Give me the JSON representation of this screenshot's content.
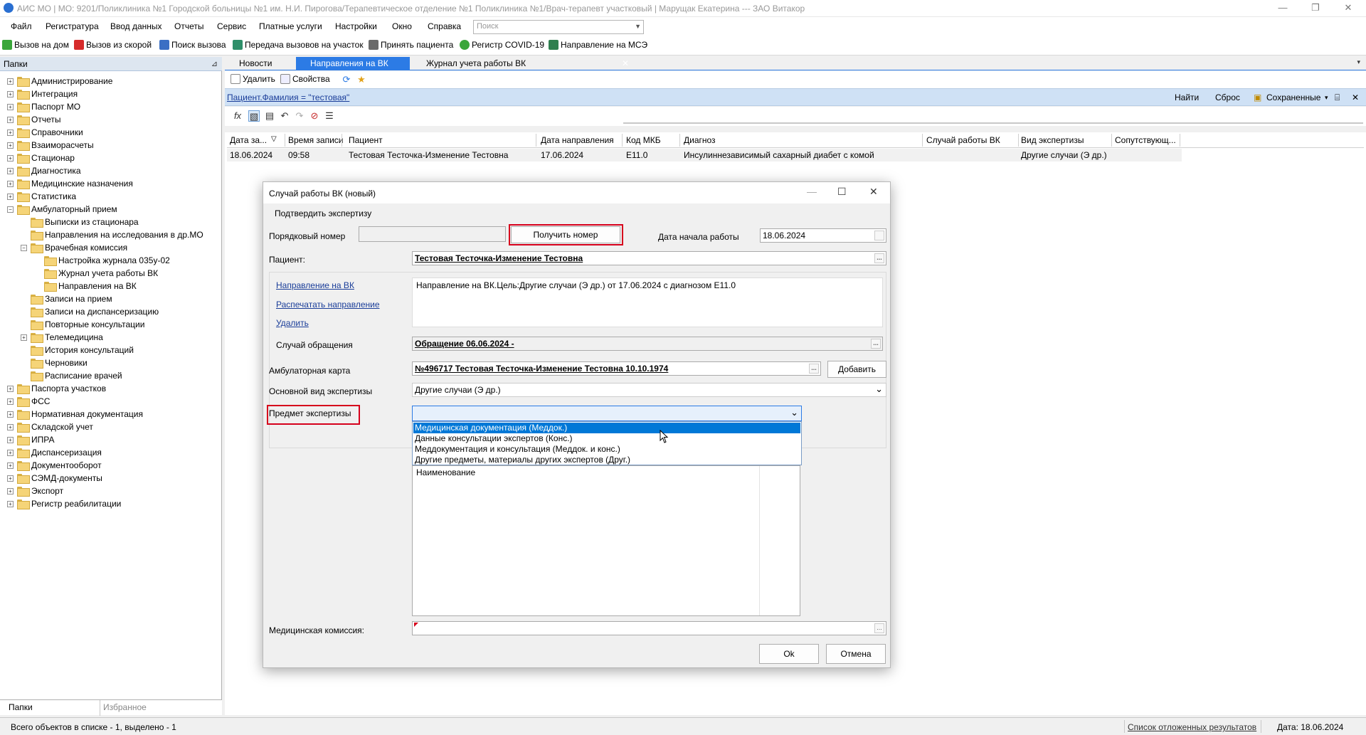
{
  "window": {
    "title": "АИС МО | МО: 9201/Поликлиника №1 Городской больницы №1 им. Н.И. Пирогова/Терапевтическое отделение №1 Поликлиника №1/Врач-терапевт участковый | Марущак Екатерина --- ЗАО Витакор",
    "minimize": "—",
    "restore": "❐",
    "close": "✕"
  },
  "menu": {
    "items": [
      "Файл",
      "Регистратура",
      "Ввод данных",
      "Отчеты",
      "Сервис",
      "Платные услуги",
      "Настройки",
      "Окно",
      "Справка"
    ],
    "search_placeholder": "Поиск"
  },
  "toolbar": {
    "items": [
      {
        "label": "Вызов на дом",
        "icon": "house-call-icon",
        "color": "#3aa63a"
      },
      {
        "label": "Вызов из скорой",
        "icon": "ambulance-icon",
        "color": "#d62b2b"
      },
      {
        "label": "Поиск вызова",
        "icon": "search-call-icon",
        "color": "#3b6fc4"
      },
      {
        "label": "Передача вызовов на участок",
        "icon": "transfer-icon",
        "color": "#2f8f6a"
      },
      {
        "label": "Принять пациента",
        "icon": "accept-patient-icon",
        "color": "#6a6a6a"
      },
      {
        "label": "Регистр COVID-19",
        "icon": "covid-icon",
        "color": "#3aa63a"
      },
      {
        "label": "Направление на МСЭ",
        "icon": "mse-icon",
        "color": "#2f7f4f"
      }
    ]
  },
  "left_panel": {
    "header": "Папки",
    "pin": "⊿",
    "tree": [
      {
        "label": "Администрирование",
        "level": 0,
        "expander": "+"
      },
      {
        "label": "Интеграция",
        "level": 0,
        "expander": "+"
      },
      {
        "label": "Паспорт МО",
        "level": 0,
        "expander": "+"
      },
      {
        "label": "Отчеты",
        "level": 0,
        "expander": "+"
      },
      {
        "label": "Справочники",
        "level": 0,
        "expander": "+"
      },
      {
        "label": "Взаиморасчеты",
        "level": 0,
        "expander": "+"
      },
      {
        "label": "Стационар",
        "level": 0,
        "expander": "+"
      },
      {
        "label": "Диагностика",
        "level": 0,
        "expander": "+"
      },
      {
        "label": "Медицинские назначения",
        "level": 0,
        "expander": "+"
      },
      {
        "label": "Статистика",
        "level": 0,
        "expander": "+"
      },
      {
        "label": "Амбулаторный прием",
        "level": 0,
        "expander": "−"
      },
      {
        "label": "Выписки из стационара",
        "level": 1,
        "expander": ""
      },
      {
        "label": "Направления на исследования в др.МО",
        "level": 1,
        "expander": ""
      },
      {
        "label": "Врачебная комиссия",
        "level": 1,
        "expander": "−"
      },
      {
        "label": "Настройка журнала 035у-02",
        "level": 2,
        "expander": ""
      },
      {
        "label": "Журнал учета работы ВК",
        "level": 2,
        "expander": ""
      },
      {
        "label": "Направления на ВК",
        "level": 2,
        "expander": ""
      },
      {
        "label": "Записи на прием",
        "level": 1,
        "expander": ""
      },
      {
        "label": "Записи на диспансеризацию",
        "level": 1,
        "expander": ""
      },
      {
        "label": "Повторные консультации",
        "level": 1,
        "expander": ""
      },
      {
        "label": "Телемедицина",
        "level": 1,
        "expander": "+"
      },
      {
        "label": "История консультаций",
        "level": 1,
        "expander": ""
      },
      {
        "label": "Черновики",
        "level": 1,
        "expander": ""
      },
      {
        "label": "Расписание врачей",
        "level": 1,
        "expander": ""
      },
      {
        "label": "Паспорта участков",
        "level": 0,
        "expander": "+"
      },
      {
        "label": "ФСС",
        "level": 0,
        "expander": "+"
      },
      {
        "label": "Нормативная документация",
        "level": 0,
        "expander": "+"
      },
      {
        "label": "Складской учет",
        "level": 0,
        "expander": "+"
      },
      {
        "label": "ИПРА",
        "level": 0,
        "expander": "+"
      },
      {
        "label": "Диспансеризация",
        "level": 0,
        "expander": "+"
      },
      {
        "label": "Документооборот",
        "level": 0,
        "expander": "+"
      },
      {
        "label": "СЭМД-документы",
        "level": 0,
        "expander": "+"
      },
      {
        "label": "Экспорт",
        "level": 0,
        "expander": "+"
      },
      {
        "label": "Регистр реабилитации",
        "level": 0,
        "expander": "+"
      }
    ],
    "tabs": [
      "Папки",
      "Избранное"
    ]
  },
  "doc_tabs": {
    "tabs": [
      "Новости",
      "Направления на ВК",
      "Журнал учета работы ВК"
    ],
    "active": 1,
    "close": "✕",
    "more": "▾"
  },
  "inner_toolbar": {
    "delete": "Удалить",
    "properties": "Свойства"
  },
  "filter": {
    "text": "Пациент.Фамилия = \"тестовая\"",
    "find": "Найти",
    "reset": "Сброс",
    "saved": "Сохраненные",
    "dropdown": "▾",
    "close": "✕"
  },
  "grid": {
    "headers": [
      "Дата за...",
      "Время записи",
      "Пациент",
      "Дата направления",
      "Код МКБ",
      "Диагноз",
      "Случай работы ВК",
      "Вид экспертизы",
      "Сопутствующ..."
    ],
    "sort_indicator": "▽",
    "row": [
      "18.06.2024",
      "09:58",
      "Тестовая Тесточка-Изменение Тестовна",
      "17.06.2024",
      "E11.0",
      "Инсулиннезависимый сахарный диабет с комой",
      "",
      "Другие случаи (Э др.)",
      ""
    ]
  },
  "dialog": {
    "title": "Случай работы ВК (новый)",
    "confirm_menu": "Подтвердить экспертизу",
    "seq_number_label": "Порядковый номер",
    "seq_number_value": "",
    "get_number_button": "Получить номер",
    "start_date_label": "Дата начала работы",
    "start_date_value": "18.06.2024",
    "patient_label": "Пациент:",
    "patient_value": "Тестовая Тесточка-Изменение Тестовна",
    "link_referral": "Направление на ВК",
    "link_print": "Распечатать направление",
    "link_delete": "Удалить",
    "referral_text": "Направление на ВК.Цель:Другие случаи (Э др.) от 17.06.2024 с диагнозом E11.0",
    "case_label": "Случай обращения",
    "case_value": "Обращение 06.06.2024 -",
    "amb_card_label": "Амбулаторная карта",
    "amb_card_value": "№496717 Тестовая Тесточка-Изменение Тестовна 10.10.1974",
    "add_button": "Добавить",
    "exam_type_label": "Основной вид экспертизы",
    "exam_type_value": "Другие случаи (Э др.)",
    "subject_label": "Предмет экспертизы",
    "subject_value": "",
    "subject_options": [
      "Медицинская документация (Меддок.)",
      "Данные консультации экспертов (Конс.)",
      "Меддокументация и консультация (Меддок. и конс.)",
      "Другие предметы, материалы других экспертов (Друг.)"
    ],
    "selected_option": 0,
    "table_header": "Наименование",
    "commission_label": "Медицинская комиссия:",
    "commission_value": "",
    "ok_button": "Ok",
    "cancel_button": "Отмена",
    "ellipsis": "...",
    "dropdown_arrow": "⌄",
    "close": "✕",
    "maximize": "☐",
    "minimize": "—"
  },
  "status": {
    "count_text": "Всего объектов в списке - 1, выделено - 1",
    "deferred_link": "Список отложенных результатов",
    "date_text": "Дата: 18.06.2024"
  },
  "colors": {
    "accent": "#2c7be5",
    "filter_bg": "#cfe1f5",
    "highlight_box": "#d6001c",
    "selection": "#0078d7"
  }
}
